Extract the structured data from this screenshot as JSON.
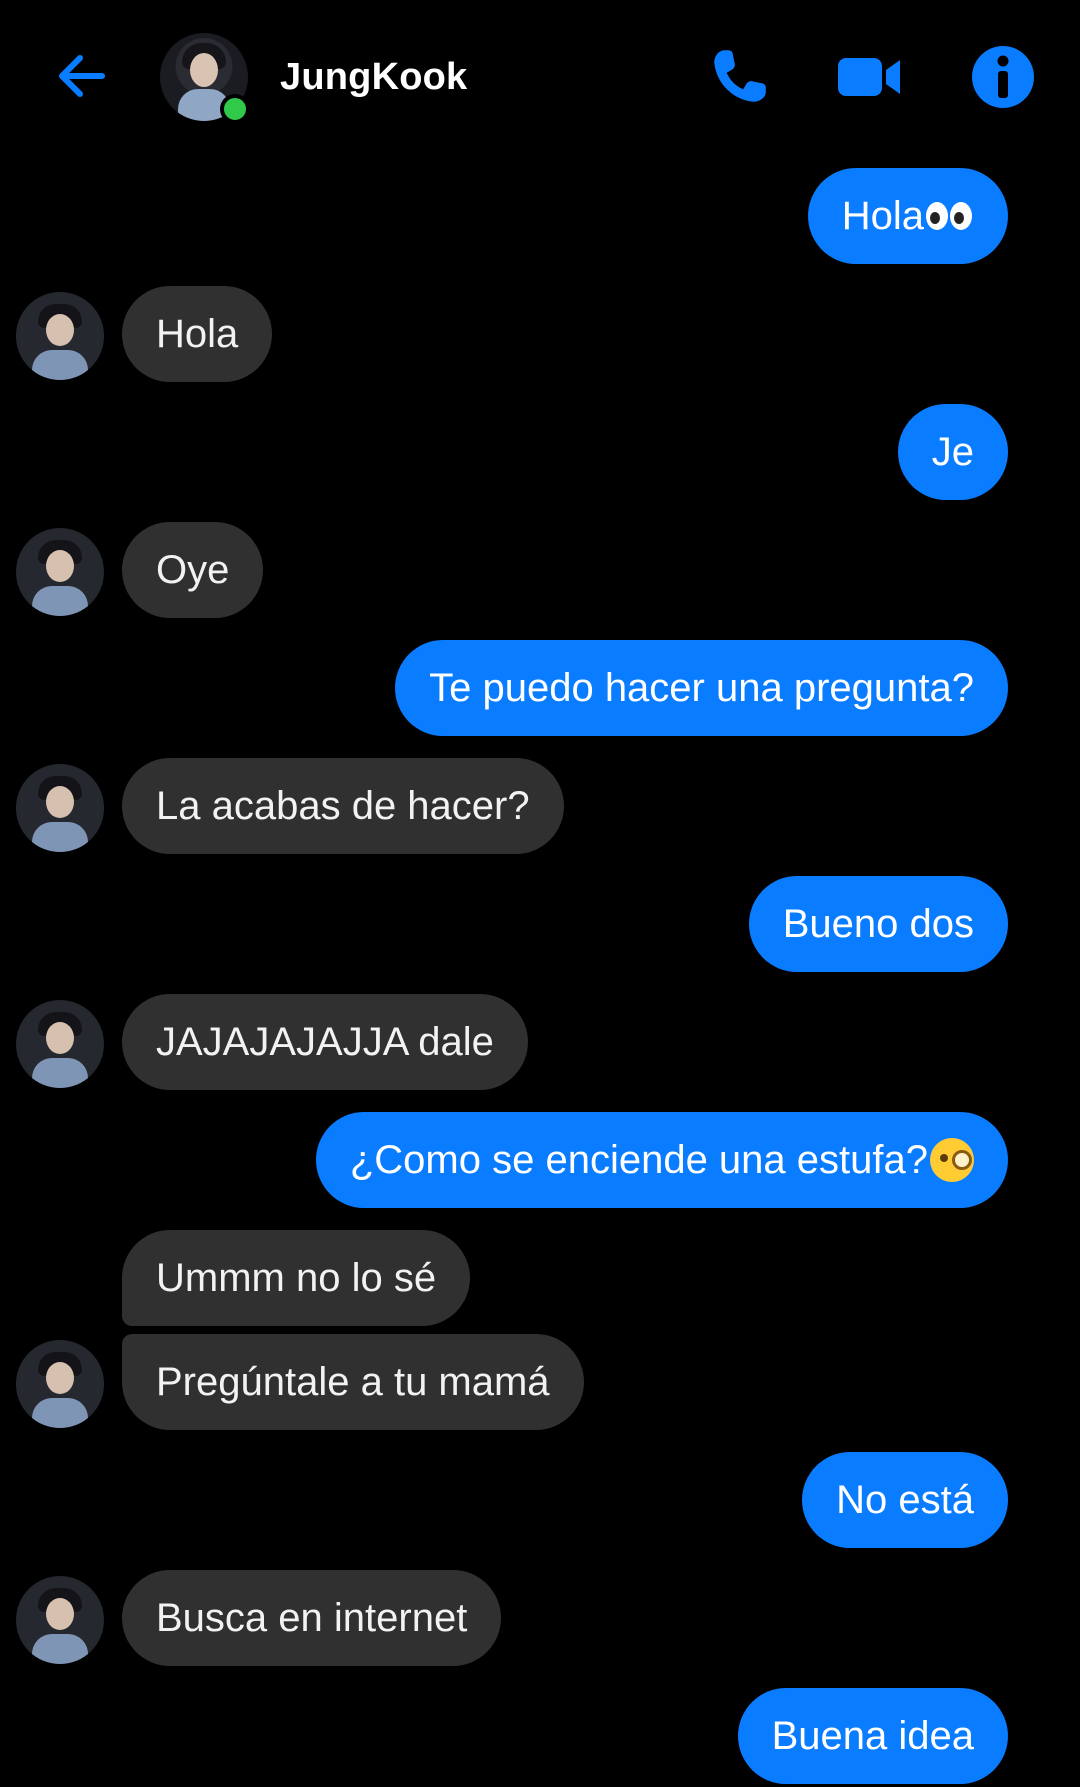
{
  "header": {
    "contact_name": "JungKook",
    "online": true,
    "icons": [
      "back-arrow-icon",
      "phone-icon",
      "video-camera-icon",
      "info-icon"
    ],
    "accent_color": "#0a7cff",
    "online_color": "#31c94a"
  },
  "messages": [
    {
      "from": "me",
      "text": "Hola"
    },
    {
      "from": "them",
      "text": "Hola"
    },
    {
      "from": "me",
      "text": "Je"
    },
    {
      "from": "them",
      "text": "Oye"
    },
    {
      "from": "me",
      "text": "Te puedo hacer una pregunta?"
    },
    {
      "from": "them",
      "text": "La acabas de hacer?"
    },
    {
      "from": "me",
      "text": "Bueno dos"
    },
    {
      "from": "them",
      "text": "JAJAJAJAJJA dale"
    },
    {
      "from": "me",
      "text": "¿Como se enciende una estufa?"
    },
    {
      "from": "them",
      "text": "Ummm no lo sé"
    },
    {
      "from": "them",
      "text": "Pregúntale a tu mamá"
    },
    {
      "from": "me",
      "text": "No está"
    },
    {
      "from": "them",
      "text": "Busca en internet"
    },
    {
      "from": "me",
      "text": "Buena idea"
    }
  ],
  "colors": {
    "outgoing_bubble": "#0a7cff",
    "incoming_bubble": "#303030",
    "background": "#000000"
  }
}
